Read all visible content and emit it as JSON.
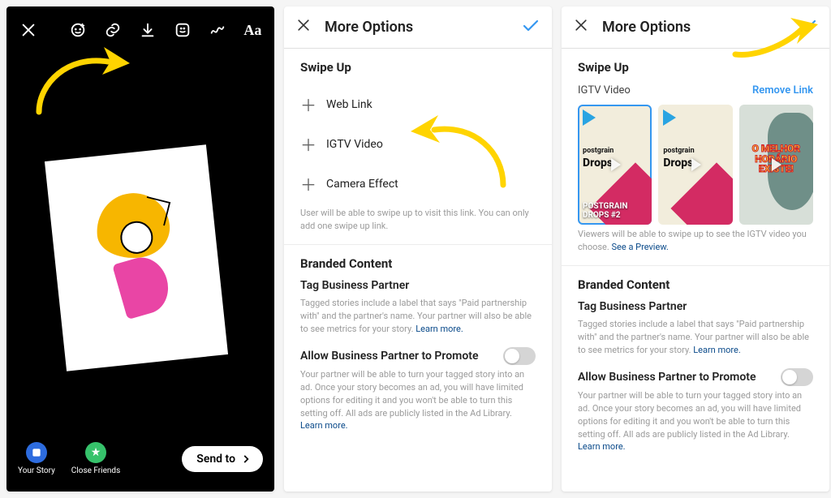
{
  "annotation_color": "#ffd400",
  "phone1": {
    "toolbar_icons": [
      "close",
      "face-plus",
      "link",
      "download",
      "sticker",
      "doodle",
      "text-aa"
    ],
    "bottom": {
      "your_story": "Your Story",
      "close_friends": "Close Friends",
      "send_to": "Send to"
    }
  },
  "phone2": {
    "header": {
      "title": "More Options"
    },
    "swipe_up": {
      "label": "Swipe Up",
      "options": [
        "Web Link",
        "IGTV Video",
        "Camera Effect"
      ],
      "hint": "User will be able to swipe up to visit this link. You can only add one swipe up link."
    },
    "branded": {
      "label": "Branded Content",
      "tag_label": "Tag Business Partner",
      "tag_hint": "Tagged stories include a label that says \"Paid partnership with\" and the partner's name. Your partner will also be able to see metrics for your story.",
      "allow_label": "Allow Business Partner to Promote",
      "allow_hint": "Your partner will be able to turn your tagged story into an ad. Once your story becomes an ad, you will have limited options for editing it and you won't be able to turn this setting off. All ads are publicly listed in the Ad Library.",
      "learn_more": "Learn more."
    }
  },
  "phone3": {
    "header": {
      "title": "More Options"
    },
    "swipe_up": {
      "label": "Swipe Up",
      "sub": "IGTV Video",
      "remove": "Remove Link",
      "thumbs": [
        {
          "brand": "postgrain",
          "drops": "Drops",
          "caption": "POSTGRAIN\nDROPS #2",
          "selected": true
        },
        {
          "brand": "postgrain",
          "drops": "Drops",
          "caption": "",
          "selected": false
        },
        {
          "caption": "O MELHOR\nHORÁRIO\nEXISTE!",
          "overlay_text": "O MELHOR HORÁRIO EXISTE!",
          "selected": false
        }
      ],
      "hint": "Viewers will be able to swipe up to see the IGTV video you choose.",
      "preview": "See a Preview."
    },
    "branded": {
      "label": "Branded Content",
      "tag_label": "Tag Business Partner",
      "tag_hint": "Tagged stories include a label that says \"Paid partnership with\" and the partner's name. Your partner will also be able to see metrics for your story.",
      "allow_label": "Allow Business Partner to Promote",
      "allow_hint": "Your partner will be able to turn your tagged story into an ad. Once your story becomes an ad, you will have limited options for editing it and you won't be able to turn this setting off. All ads are publicly listed in the Ad Library.",
      "learn_more": "Learn more."
    }
  }
}
